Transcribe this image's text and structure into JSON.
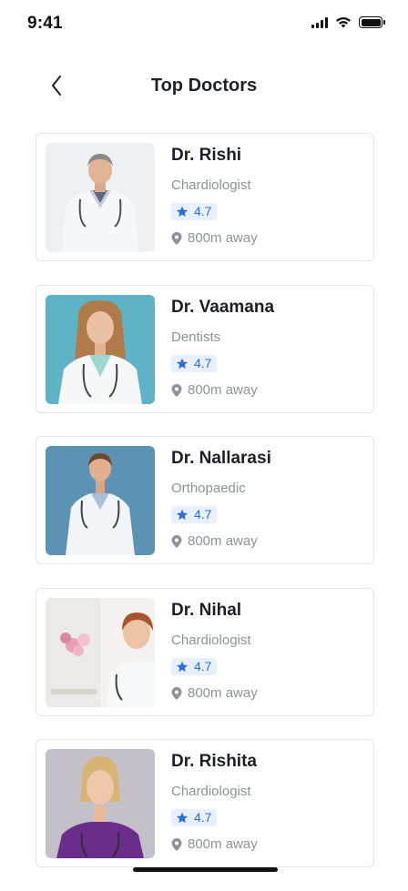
{
  "status_bar": {
    "time": "9:41"
  },
  "header": {
    "title": "Top Doctors"
  },
  "doctors": [
    {
      "name": "Dr. Rishi",
      "specialty": "Chardiologist",
      "rating": "4.7",
      "distance": "800m away"
    },
    {
      "name": "Dr. Vaamana",
      "specialty": "Dentists",
      "rating": "4.7",
      "distance": "800m away"
    },
    {
      "name": "Dr. Nallarasi",
      "specialty": "Orthopaedic",
      "rating": "4.7",
      "distance": "800m away"
    },
    {
      "name": "Dr. Nihal",
      "specialty": "Chardiologist",
      "rating": "4.7",
      "distance": "800m away"
    },
    {
      "name": "Dr. Rishita",
      "specialty": "Chardiologist",
      "rating": "4.7",
      "distance": "800m away"
    }
  ],
  "colors": {
    "accent": "#2f6fdd",
    "rating_bg": "#e8effd",
    "muted_text": "#8e929a",
    "card_border": "#e4e6ea"
  },
  "icons": [
    "back-chevron-icon",
    "star-icon",
    "location-pin-icon",
    "signal-icon",
    "wifi-icon",
    "battery-icon"
  ]
}
